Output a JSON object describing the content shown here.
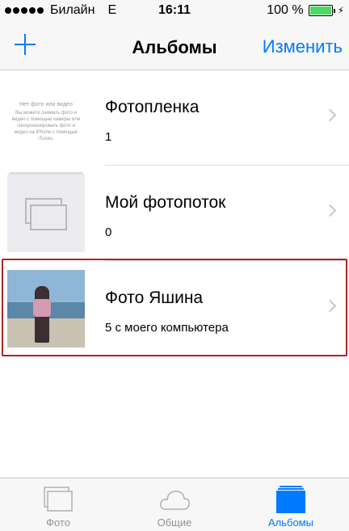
{
  "status_bar": {
    "carrier": "Билайн",
    "network": "E",
    "time": "16:11",
    "battery_percent": "100 %",
    "battery_level": 1.0
  },
  "nav": {
    "title": "Альбомы",
    "edit_label": "Изменить",
    "add_icon": "plus-icon"
  },
  "albums": [
    {
      "name": "Фотопленка",
      "count": "1",
      "thumb_lines": [
        "Нет фото или видео",
        "Вы можете снимать фото и",
        "видео с помощью камеры или",
        "синхронизировать фото и",
        "видео на iPhone с помощью",
        "iTunes."
      ]
    },
    {
      "name": "Мой фотопоток",
      "count": "0"
    },
    {
      "name": "Фото Яшина",
      "count": "5 с моего компьютера"
    }
  ],
  "tabs": [
    {
      "label": "Фото",
      "icon": "photos-icon",
      "active": false
    },
    {
      "label": "Общие",
      "icon": "cloud-icon",
      "active": false
    },
    {
      "label": "Альбомы",
      "icon": "albums-icon",
      "active": true
    }
  ],
  "colors": {
    "accent": "#007aff",
    "highlight": "#b22222",
    "battery": "#4cd964"
  }
}
